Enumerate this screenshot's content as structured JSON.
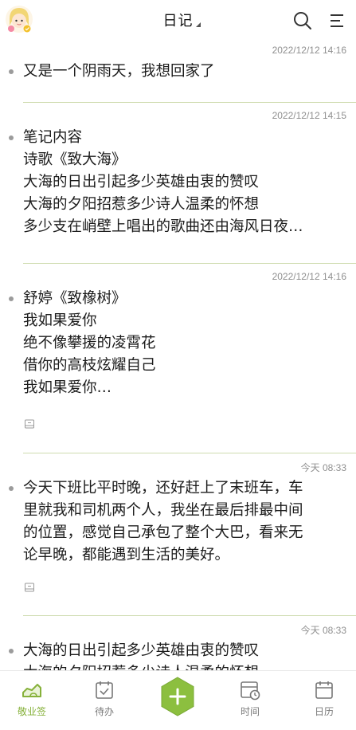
{
  "header": {
    "title": "日记",
    "avatar_icon": "girl-avatar-icon",
    "search_icon": "search-icon",
    "menu_icon": "menu-icon"
  },
  "entries": [
    {
      "timestamp": "2022/12/12 14:16",
      "lines": [
        "又是一个阴雨天，我想回家了"
      ]
    },
    {
      "timestamp": "2022/12/12 14:15",
      "lines": [
        "笔记内容",
        "诗歌《致大海》",
        "大海的日出引起多少英雄由衷的赞叹",
        "大海的夕阳招惹多少诗人温柔的怀想",
        "多少支在峭壁上唱出的歌曲还由海风日夜…"
      ]
    },
    {
      "timestamp": "2022/12/12 14:16",
      "lines": [
        "舒婷《致橡树》",
        "我如果爱你",
        "绝不像攀援的凌霄花",
        "借你的高枝炫耀自己",
        "我如果爱你…"
      ],
      "has_attachment": true
    },
    {
      "timestamp": "今天 08:33",
      "lines": [
        "今天下班比平时晚，还好赶上了末班车，车",
        "里就我和司机两个人，我坐在最后排最中间",
        "的位置，感觉自己承包了整个大巴，看来无",
        "论早晚，都能遇到生活的美好。"
      ],
      "has_attachment": true
    },
    {
      "timestamp": "今天 08:33",
      "lines": [
        "大海的日出引起多少英雄由衷的赞叹",
        "大海的夕阳招惹多少诗人温柔的怀想"
      ]
    }
  ],
  "tabs": [
    {
      "label": "敬业签",
      "icon": "cloud-note-icon",
      "active": true
    },
    {
      "label": "待办",
      "icon": "todo-check-icon",
      "active": false
    },
    {
      "label": "",
      "icon": "add-icon",
      "active": false
    },
    {
      "label": "时间",
      "icon": "clock-calendar-icon",
      "active": false
    },
    {
      "label": "日历",
      "icon": "calendar-icon",
      "active": false
    }
  ],
  "colors": {
    "accent": "#86b13a",
    "fab": "#8cbf3f",
    "divider": "#cfdcb0",
    "timestamp": "#8f8f8f"
  }
}
